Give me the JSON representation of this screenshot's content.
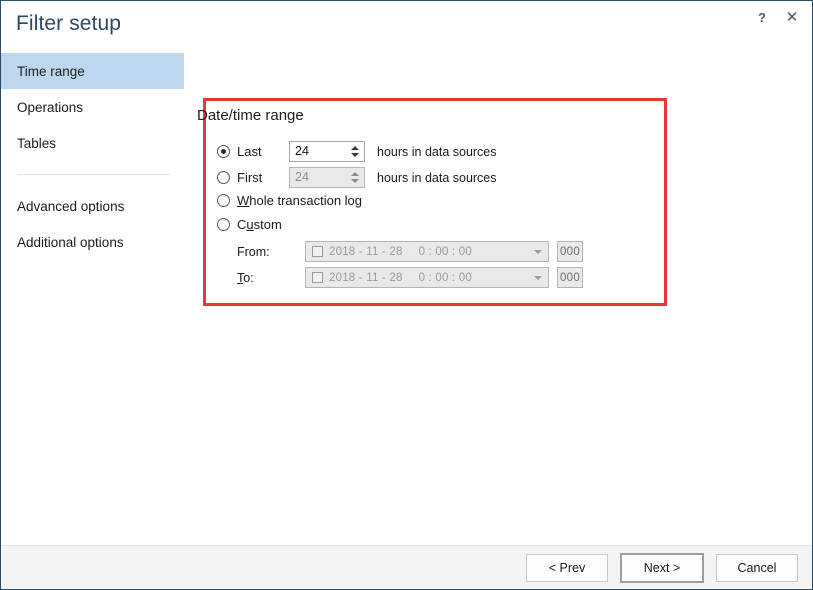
{
  "window": {
    "title": "Filter setup",
    "help_icon": "question-mark-icon",
    "close_icon": "close-x-icon",
    "help_label": "?",
    "close_label": "✕"
  },
  "sidebar": {
    "items": [
      {
        "label": "Time range",
        "selected": true
      },
      {
        "label": "Operations",
        "selected": false
      },
      {
        "label": "Tables",
        "selected": false
      }
    ],
    "items_secondary": [
      {
        "label": "Advanced options"
      },
      {
        "label": "Additional options"
      }
    ]
  },
  "main": {
    "group_title": "Date/time range",
    "options": {
      "last": {
        "label": "Last",
        "selected": true,
        "value": "24",
        "suffix": "hours in data sources"
      },
      "first": {
        "label": "First",
        "selected": false,
        "value": "24",
        "suffix": "hours in data sources",
        "disabled": true
      },
      "whole_log": {
        "label_pre": "",
        "label_accel": "W",
        "label_post": "hole transaction log",
        "selected": false
      },
      "custom": {
        "label_pre": "C",
        "label_accel": "u",
        "label_post": "stom",
        "selected": false
      }
    },
    "custom_range": {
      "from_label": "From:",
      "to_label_accel": "T",
      "to_label_post": "o:",
      "from": {
        "date": "2018 - 11 - 28",
        "time": "0 : 00 : 00",
        "ms": "000",
        "checked": false
      },
      "to": {
        "date": "2018 - 11 - 28",
        "time": "0 : 00 : 00",
        "ms": "000",
        "checked": false
      }
    }
  },
  "footer": {
    "prev_label": "< Prev",
    "next_label": "Next >",
    "cancel_label": "Cancel"
  },
  "colors": {
    "accent": "#2c4762",
    "selection": "#bdd7ee",
    "annotation": "#e03b3b",
    "border": "#2b4a66"
  }
}
